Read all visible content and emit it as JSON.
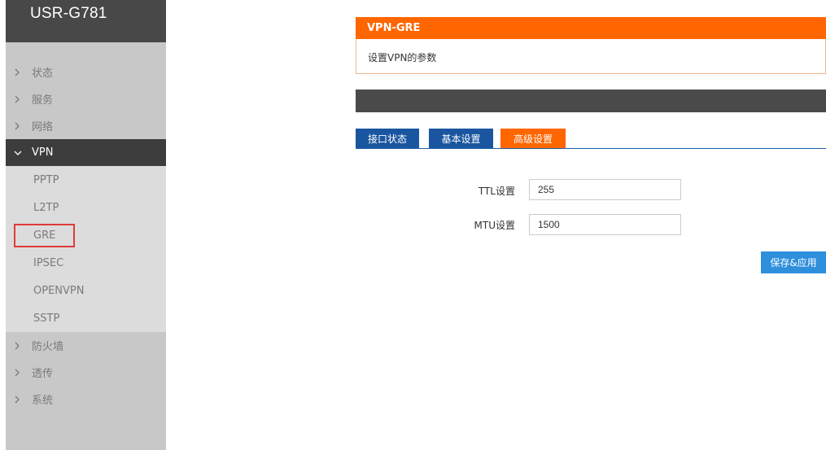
{
  "app": {
    "brand": "USR-G781"
  },
  "sidebar": {
    "items": [
      {
        "label": "状态"
      },
      {
        "label": "服务"
      },
      {
        "label": "网络"
      },
      {
        "label": "VPN"
      },
      {
        "label": "防火墙"
      },
      {
        "label": "透传"
      },
      {
        "label": "系统"
      }
    ],
    "vpn_subitems": [
      {
        "label": "PPTP"
      },
      {
        "label": "L2TP"
      },
      {
        "label": "GRE"
      },
      {
        "label": "IPSEC"
      },
      {
        "label": "OPENVPN"
      },
      {
        "label": "SSTP"
      }
    ]
  },
  "main": {
    "header_title": "VPN-GRE",
    "description": "设置VPN的参数",
    "tabs": [
      {
        "label": "接口状态"
      },
      {
        "label": "基本设置"
      },
      {
        "label": "高级设置"
      }
    ],
    "fields": {
      "ttl": {
        "label": "TTL设置",
        "value": "255"
      },
      "mtu": {
        "label": "MTU设置",
        "value": "1500"
      }
    },
    "save_label": "保存&应用"
  },
  "colors": {
    "accent": "#ff6600",
    "tab_blue": "#1a56a0",
    "button_blue": "#2e8fdc",
    "sidebar_bg": "#c8c8c8",
    "highlight_box": "#e03a3a"
  },
  "icons": {
    "collapsed": "chevron-right-icon",
    "expanded": "chevron-down-icon"
  }
}
